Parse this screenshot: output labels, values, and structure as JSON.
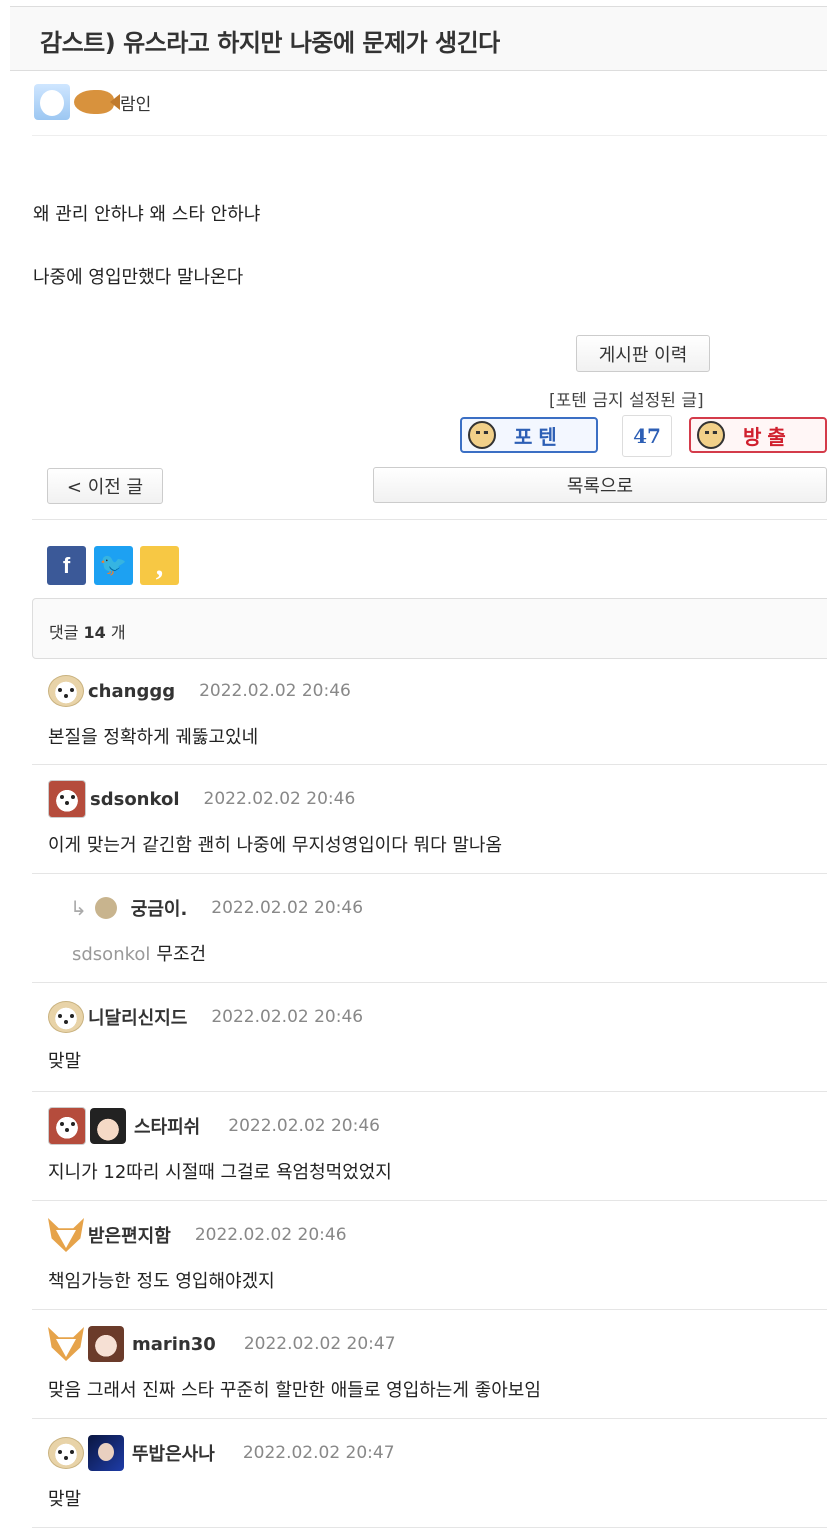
{
  "post": {
    "title": "감스트) 유스라고 하지만 나중에 문제가 생긴다",
    "author": "람인",
    "body_lines": [
      "왜 관리 안하냐 왜 스타 안하냐",
      "나중에 영입만했다 말나온다"
    ]
  },
  "actions": {
    "history_label": "게시판 이력",
    "notice": "[포텐 금지 설정된 글]",
    "upvote_label": "포텐",
    "vote_count": "47",
    "downvote_label": "방출",
    "prev_label": "< 이전 글",
    "list_label": "목록으로"
  },
  "share": {
    "facebook": "f",
    "twitter": "🐦",
    "kakao": ","
  },
  "comments_header": {
    "prefix": "댓글",
    "count": "14",
    "suffix": "개"
  },
  "comments": [
    {
      "author": "changgg",
      "date": "2022.02.02 20:46",
      "text": "본질을 정확하게 궤뚫고있네"
    },
    {
      "author": "sdsonkol",
      "date": "2022.02.02 20:46",
      "text": "이게 맞는거 같긴함 괜히 나중에 무지성영입이다 뭐다 말나옴"
    },
    {
      "author": "궁금이.",
      "date": "2022.02.02 20:46",
      "reply_to": "sdsonkol",
      "text": "무조건"
    },
    {
      "author": "니달리신지드",
      "date": "2022.02.02 20:46",
      "text": "맞말"
    },
    {
      "author": "스타피쉬",
      "date": "2022.02.02 20:46",
      "text": "지니가 12따리 시절때 그걸로 욕엄청먹었었지"
    },
    {
      "author": "받은편지함",
      "date": "2022.02.02 20:46",
      "text": "책임가능한 정도 영입해야겠지"
    },
    {
      "author": "marin30",
      "date": "2022.02.02 20:47",
      "text": "맞음 그래서 진짜 스타 꾸준히 할만한 애들로 영입하는게 좋아보임"
    },
    {
      "author": "뚜밥은사나",
      "date": "2022.02.02 20:47",
      "text": "맞말"
    }
  ]
}
